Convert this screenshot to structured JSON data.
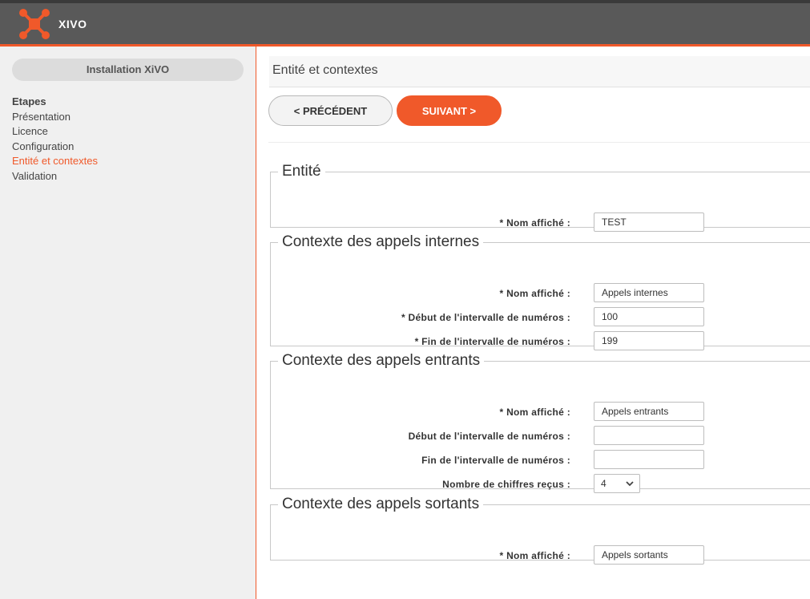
{
  "header": {
    "brand": "XIVO",
    "logo_icon": "xivo-logo-icon",
    "accent_color": "#f0592a"
  },
  "sidebar": {
    "title": "Installation XiVO",
    "steps_heading": "Etapes",
    "steps": [
      {
        "label": "Présentation",
        "active": false
      },
      {
        "label": "Licence",
        "active": false
      },
      {
        "label": "Configuration",
        "active": false
      },
      {
        "label": "Entité et contextes",
        "active": true
      },
      {
        "label": "Validation",
        "active": false
      }
    ]
  },
  "main": {
    "title": "Entité et contextes",
    "prev_label": "< PRÉCÉDENT",
    "next_label": "SUIVANT >",
    "sections": {
      "entity": {
        "legend": "Entité",
        "fields": [
          {
            "label": "* Nom affiché :",
            "value": "TEST"
          }
        ]
      },
      "internal": {
        "legend": "Contexte des appels internes",
        "fields": [
          {
            "label": "* Nom affiché :",
            "value": "Appels internes"
          },
          {
            "label": "* Début de l'intervalle de numéros :",
            "value": "100"
          },
          {
            "label": "* Fin de l'intervalle de numéros :",
            "value": "199"
          }
        ]
      },
      "incoming": {
        "legend": "Contexte des appels entrants",
        "fields": [
          {
            "label": "* Nom affiché :",
            "value": "Appels entrants"
          },
          {
            "label": "Début de l'intervalle de numéros :",
            "value": ""
          },
          {
            "label": "Fin de l'intervalle de numéros :",
            "value": ""
          },
          {
            "label": "Nombre de chiffres reçus :",
            "value": "4"
          }
        ]
      },
      "outgoing": {
        "legend": "Contexte des appels sortants",
        "fields": [
          {
            "label": "* Nom affiché :",
            "value": "Appels sortants"
          }
        ]
      }
    }
  }
}
